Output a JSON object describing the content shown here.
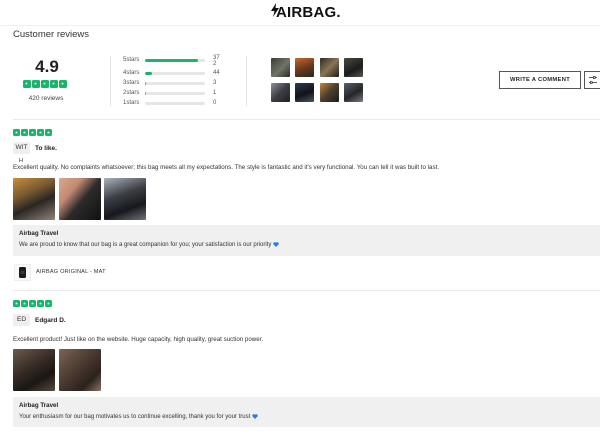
{
  "brand": {
    "name": "AIRBAG."
  },
  "header": {
    "title": "Customer reviews"
  },
  "summary": {
    "score": "4.9",
    "rating_stars": 5,
    "count_text": "420 reviews",
    "distribution": [
      {
        "label": "5stars",
        "count": "37",
        "count2": "2",
        "fraction": 0.88
      },
      {
        "label": "4stars",
        "count": "44",
        "fraction": 0.11
      },
      {
        "label": "3stars",
        "count": "3",
        "fraction": 0.01
      },
      {
        "label": "2stars",
        "count": "1",
        "fraction": 0.005
      },
      {
        "label": "1stars",
        "count": "0",
        "fraction": 0.0
      }
    ]
  },
  "actions": {
    "write_label": "WRITE A COMMENT",
    "filter_icon": "sliders-icon"
  },
  "reviews": [
    {
      "rating": 5,
      "avatar": "WIT",
      "avatar_line2": "H",
      "name": "To like.",
      "text": "Excellent quality. No complaints whatsoever; this bag meets all my expectations. The style is fantastic and it's very functional. You can tell it was built to last.",
      "reply": {
        "title": "Airbag Travel",
        "text": "We are proud to know that our bag is a great companion for you; your satisfaction is our priority"
      },
      "product": "AIRBAG ORIGINAL - MAT"
    },
    {
      "rating": 5,
      "avatar": "ED",
      "name": "Edgard D.",
      "text": "Excellent product! Just like on the website. Huge capacity, high quality, great suction power.",
      "reply": {
        "title": "Airbag Travel",
        "text": "Your enthusiasm for our bag motivates us to continue excelling, thank you for your trust"
      }
    }
  ],
  "colors": {
    "accent": "#19b66a",
    "reply_bg": "#f0f0f0",
    "heart": "#2d7be5"
  }
}
